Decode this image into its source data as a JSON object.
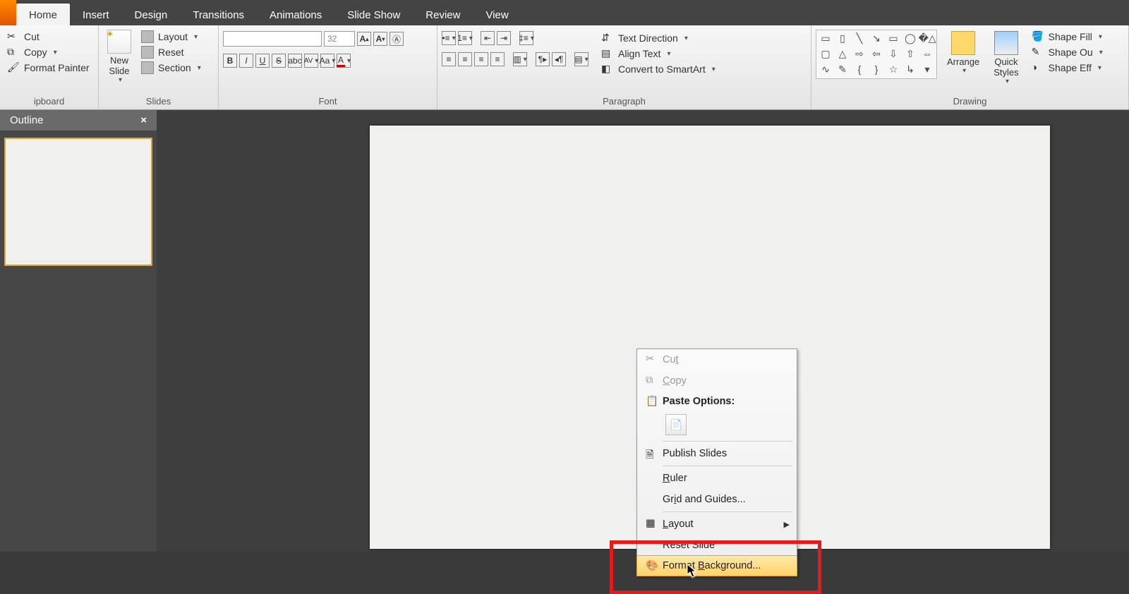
{
  "tabs": {
    "home": "Home",
    "insert": "Insert",
    "design": "Design",
    "transitions": "Transitions",
    "animations": "Animations",
    "slideshow": "Slide Show",
    "review": "Review",
    "view": "View"
  },
  "clipboard": {
    "cut": "Cut",
    "copy": "Copy",
    "formatpainter": "Format Painter",
    "group": "ipboard"
  },
  "slides": {
    "newslide": "New\nSlide",
    "layout": "Layout",
    "reset": "Reset",
    "section": "Section",
    "group": "Slides"
  },
  "font": {
    "size": "32",
    "group": "Font"
  },
  "paragraph": {
    "textdirection": "Text Direction",
    "aligntext": "Align Text",
    "convert": "Convert to SmartArt",
    "group": "Paragraph"
  },
  "drawing": {
    "arrange": "Arrange",
    "quickstyles": "Quick\nStyles",
    "shapefill": "Shape Fill",
    "shapeoutline": "Shape Ou",
    "shapeeffects": "Shape Eff",
    "group": "Drawing"
  },
  "sidepane": {
    "tab": "Outline"
  },
  "contextmenu": {
    "cut": "Cut",
    "copy": "Copy",
    "pasteoptions": "Paste Options:",
    "publish": "Publish Slides",
    "ruler": "Ruler",
    "grid": "Grid and Guides...",
    "layout": "Layout",
    "reset": "Reset Slide",
    "formatbg": "Format Background..."
  }
}
